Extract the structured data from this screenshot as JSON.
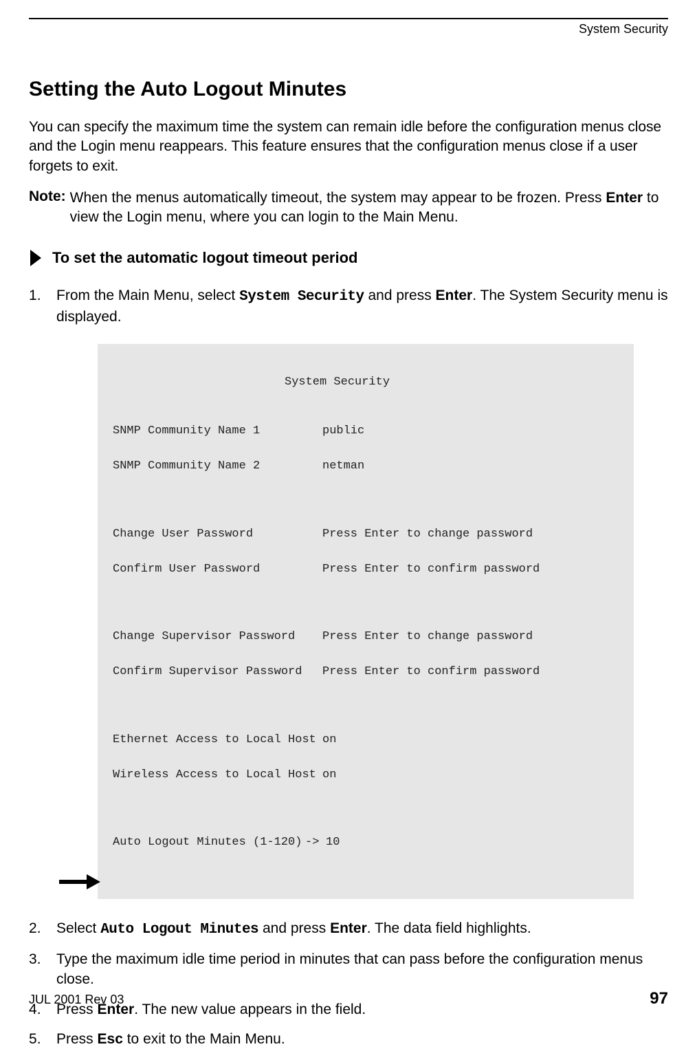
{
  "header": {
    "running_title": "System Security"
  },
  "section_title": "Setting the Auto Logout Minutes",
  "intro_paragraph": "You can specify the maximum time the system can remain idle before the configuration menus close and the Login menu reappears. This feature ensures that the configuration menus close if a user forgets to exit.",
  "note": {
    "label": "Note:",
    "text_before_enter": "When the menus automatically timeout, the system may appear to be frozen. Press ",
    "enter_key": "Enter",
    "text_after_enter": " to view the Login menu, where you can login to the Main Menu."
  },
  "procedure_title": "To set the automatic logout timeout period",
  "step1": {
    "prefix": "From the Main Menu, select ",
    "menu_item": "System Security",
    "mid": " and press ",
    "key": "Enter",
    "suffix": ". The System Security menu is displayed."
  },
  "terminal": {
    "title": "System Security",
    "rows": [
      {
        "label": "SNMP Community Name 1",
        "value": "public"
      },
      {
        "label": "SNMP Community Name 2",
        "value": "netman"
      }
    ],
    "rows2": [
      {
        "label": "Change User Password",
        "value": "Press Enter to change password"
      },
      {
        "label": "Confirm User Password",
        "value": "Press Enter to confirm password"
      }
    ],
    "rows3": [
      {
        "label": "Change Supervisor Password",
        "value": "Press Enter to change password"
      },
      {
        "label": "Confirm Supervisor Password",
        "value": "Press Enter to confirm password"
      }
    ],
    "rows4": [
      {
        "label": "Ethernet Access to Local Host",
        "value": "on"
      },
      {
        "label": "Wireless Access to Local Host",
        "value": "on"
      }
    ],
    "highlight": {
      "label": "Auto Logout Minutes (1-120)",
      "cursor": "->",
      "value": "10"
    }
  },
  "step2": {
    "prefix": "Select ",
    "menu_item": "Auto Logout Minutes",
    "mid": " and press ",
    "key": "Enter",
    "suffix": ". The data field highlights."
  },
  "step3": "Type the maximum idle time period in minutes that can pass before the configuration menus close.",
  "step4": {
    "prefix": "Press ",
    "key": "Enter",
    "suffix": ". The new value appears in the field."
  },
  "step5": {
    "prefix": "Press ",
    "key": "Esc",
    "suffix": " to exit to the Main Menu."
  },
  "footer": {
    "revision": "JUL 2001 Rev 03",
    "page_number": "97"
  }
}
